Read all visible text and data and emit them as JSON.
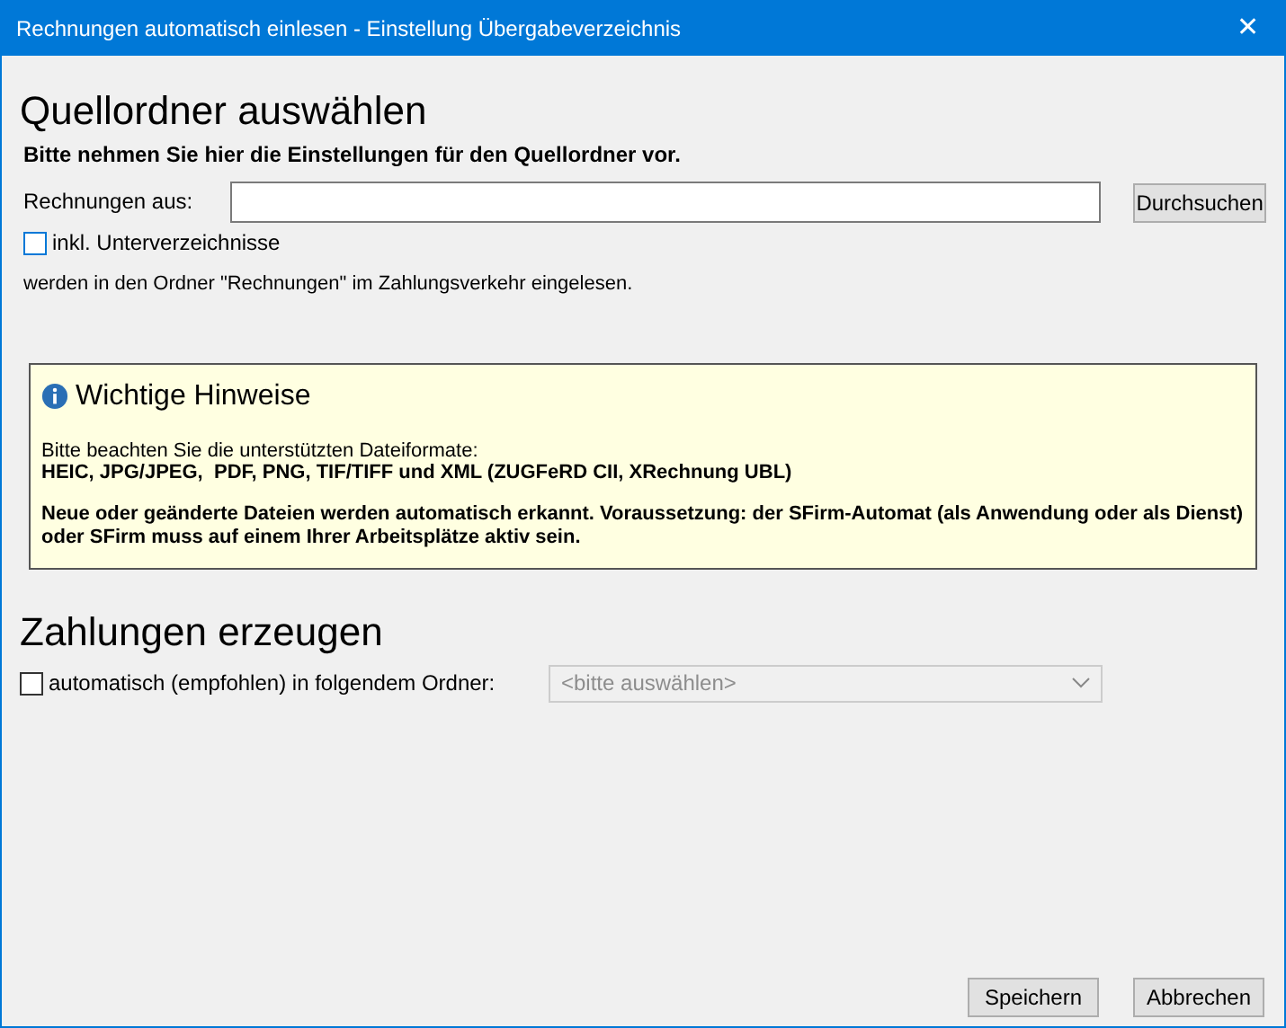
{
  "window": {
    "title": "Rechnungen automatisch einlesen - Einstellung Übergabeverzeichnis",
    "close": "✕"
  },
  "source": {
    "heading": "Quellordner auswählen",
    "intro": "Bitte nehmen Sie hier die Einstellungen für den Quellordner vor.",
    "label": "Rechnungen aus:",
    "browse": "Durchsuchen",
    "subfolders": {
      "label": "inkl. Unterverzeichnisse",
      "checked": false
    },
    "note": "werden in den Ordner \"Rechnungen\" im Zahlungsverkehr eingelesen."
  },
  "notice": {
    "title": "Wichtige Hinweise",
    "formats_intro": "Bitte beachten Sie die unterstützten Dateiformate:",
    "formats": "HEIC, JPG/JPEG,  PDF, PNG, TIF/TIFF und XML (ZUGFeRD CII, XRechnung UBL)",
    "warning": "Neue oder geänderte Dateien werden automatisch erkannt. Voraussetzung: der SFirm-Automat (als Anwendung oder als Dienst) oder SFirm muss auf einem Ihrer Arbeitsplätze aktiv sein."
  },
  "payments": {
    "heading": "Zahlungen erzeugen",
    "auto": {
      "label": "automatisch (empfohlen) in folgendem Ordner:",
      "checked": false
    },
    "folder": {
      "value": "<bitte auswählen>",
      "disabled": true
    }
  },
  "buttons": [
    "Speichern",
    "Abbrechen"
  ]
}
